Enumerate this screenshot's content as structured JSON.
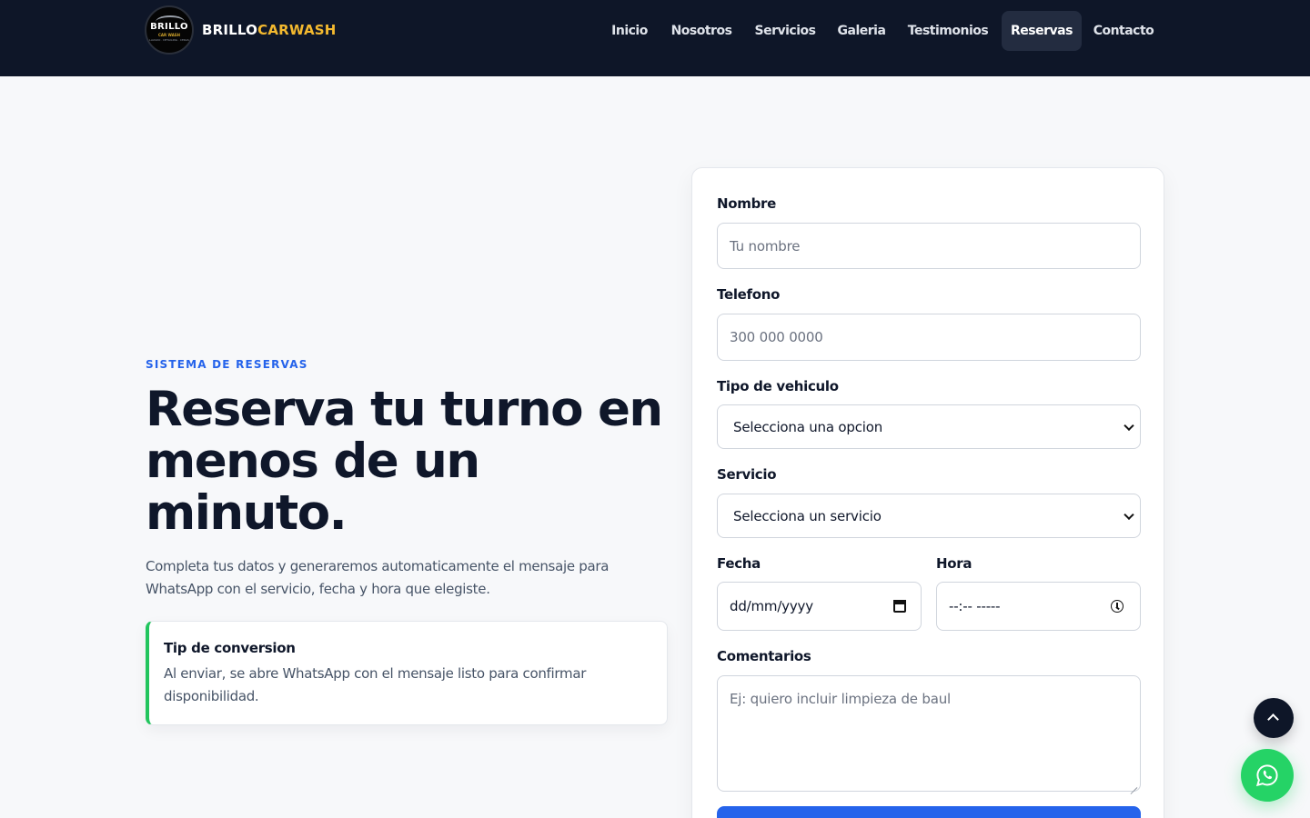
{
  "header": {
    "logo": {
      "text": "BRILLO",
      "sub": "CAR WASH",
      "tag": "LAVADO · DETAILING · CERAS"
    },
    "brand_primary": "BRILLO",
    "brand_accent": "CARWASH",
    "brand_accent_color": "#f3b92f",
    "background_color": "#0e1628",
    "nav": [
      {
        "label": "Inicio",
        "active": false
      },
      {
        "label": "Nosotros",
        "active": false
      },
      {
        "label": "Servicios",
        "active": false
      },
      {
        "label": "Galeria",
        "active": false
      },
      {
        "label": "Testimonios",
        "active": false
      },
      {
        "label": "Reservas",
        "active": true
      },
      {
        "label": "Contacto",
        "active": false
      }
    ]
  },
  "hero": {
    "eyebrow": "SISTEMA DE RESERVAS",
    "title": "Reserva tu turno en menos de un minuto.",
    "subtitle": "Completa tus datos y generaremos automaticamente el mensaje para WhatsApp con el servicio, fecha y hora que elegiste.",
    "tip": {
      "title": "Tip de conversion",
      "body": "Al enviar, se abre WhatsApp con el mensaje listo para confirmar disponibilidad.",
      "accent_color": "#22c55e"
    }
  },
  "form": {
    "nombre": {
      "label": "Nombre",
      "placeholder": "Tu nombre"
    },
    "telefono": {
      "label": "Telefono",
      "placeholder": "300 000 0000"
    },
    "vehiculo": {
      "label": "Tipo de vehiculo",
      "selected": "Selecciona una opcion"
    },
    "servicio": {
      "label": "Servicio",
      "selected": "Selecciona un servicio"
    },
    "fecha": {
      "label": "Fecha",
      "placeholder": "dd/mm/yyyy"
    },
    "hora": {
      "label": "Hora",
      "placeholder": "--:-- -----"
    },
    "comentarios": {
      "label": "Comentarios",
      "placeholder": "Ej: quiero incluir limpieza de baul"
    },
    "submit_color": "#2563eb"
  },
  "floating": {
    "scroll_top_icon": "chevron-up-icon",
    "whatsapp_icon": "whatsapp-icon",
    "whatsapp_color": "#25d366"
  }
}
